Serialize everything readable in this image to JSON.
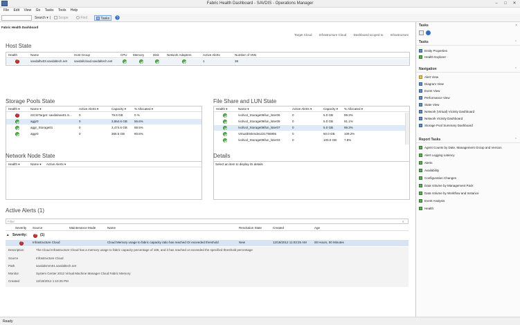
{
  "window": {
    "title": "Fabric Health Dashboard - SAVDIS - Operations Manager",
    "minimize": "–",
    "maximize": "□",
    "close": "✕"
  },
  "menu": [
    "File",
    "Edit",
    "View",
    "Go",
    "Tasks",
    "Tools",
    "Help"
  ],
  "toolbar": {
    "search_placeholder": "",
    "search": "Search",
    "scope": "Scope",
    "find": "Find",
    "tasks": "Tasks"
  },
  "dashboard": {
    "title": "Fabric Health Dashboard",
    "target_label": "Target Cloud",
    "target_value": "Infrastructure Cloud",
    "scope_label": "Dashboard scoped to",
    "scope_value": "Infrastructure"
  },
  "host_state": {
    "title": "Host State",
    "columns": [
      "Health",
      "Name",
      "Host Group",
      "CPU",
      "Memory",
      "Disk",
      "Network Adapters",
      "Active Alerts",
      "Number of VMs"
    ],
    "rows": [
      {
        "health": "critical",
        "name": "savdalhv03.savdaltech.net",
        "host_group": "savdal\\cloud.savdaltech.net",
        "cpu": "ok",
        "memory": "ok",
        "disk": "ok",
        "network": "ok",
        "alerts": "1",
        "vms": "38"
      }
    ]
  },
  "storage_pools": {
    "title": "Storage Pools State",
    "columns": [
      "Health",
      "Name",
      "Active Alerts",
      "Capacity",
      "% Allocated"
    ],
    "rows": [
      {
        "health": "critical",
        "name": "iSCSITarget: savdalnas01.S...",
        "alerts": "0",
        "capacity": "79.9 GB",
        "allocated": "0 %"
      },
      {
        "health": "ok",
        "name": "aggr0",
        "alerts": "0",
        "capacity": "3,864.6 GB",
        "allocated": "56.6%"
      },
      {
        "health": "ok",
        "name": "aggr_Storage01",
        "alerts": "0",
        "capacity": "3,474.6 GB",
        "allocated": "88.5%"
      },
      {
        "health": "ok",
        "name": "aggr0",
        "alerts": "0",
        "capacity": "365.5 GB",
        "allocated": "80.6%"
      }
    ]
  },
  "file_share": {
    "title": "File Share and LUN State",
    "columns": [
      "Health",
      "Name",
      "Active Alerts",
      "Capacity",
      "% Allocated"
    ],
    "rows": [
      {
        "health": "ok",
        "name": "/vol/vol_Storage09/lun_lster06",
        "alerts": "0",
        "capacity": "5.0 GB",
        "allocated": "99.3%"
      },
      {
        "health": "ok",
        "name": "/vol/vol_Storage09/lun_lster09",
        "alerts": "0",
        "capacity": "5.0 GB",
        "allocated": "91.1%"
      },
      {
        "health": "ok",
        "name": "/vol/vol_Storage09/lun_lster07",
        "alerts": "0",
        "capacity": "5.0 GB",
        "allocated": "99.3%"
      },
      {
        "health": "ok",
        "name": "VirtualDiskIndex221756955",
        "alerts": "0",
        "capacity": "50.0 GB",
        "allocated": "109.2%"
      },
      {
        "health": "ok",
        "name": "/vol/vol_Storage09/lun_lster03",
        "alerts": "0",
        "capacity": "100.0 GB",
        "allocated": "7.8%"
      }
    ]
  },
  "network_node": {
    "title": "Network Node State",
    "columns": [
      "Health",
      "Name",
      "Active Alerts"
    ]
  },
  "details": {
    "title": "Details",
    "placeholder": "Select an item to display its details"
  },
  "active_alerts": {
    "title": "Active Alerts (1)",
    "filter_placeholder": "Filter",
    "columns": [
      "Severity",
      "Source",
      "Maintenance Mode",
      "Name",
      "Resolution State",
      "Created",
      "Age"
    ],
    "group_label": "Severity:",
    "group_count": "(1)",
    "alert": {
      "source": "Infrastructure Cloud",
      "name": "Cloud Memory usage to fabric capacity ratio has reached Or exceeded threshold",
      "resolution": "New",
      "created": "12/18/2012 11:03:25 AM",
      "age": "00 Hours, 00 Minutes"
    },
    "detail": {
      "description_label": "Description",
      "description": "The Cloud Infrastructure Cloud has a memory usage to fabric capacity percentage of 108, and it has reached or exceeded the specified threshold percentage",
      "source_label": "Source",
      "source": "Infrastructure Cloud",
      "path_label": "Path",
      "path": "savdalvmm01.savdaltech.net",
      "monitor_label": "Monitor",
      "monitor": "System Center 2012 Virtual Machine Manager Cloud Fabric Memory",
      "created_label": "Created",
      "created": "12/18/2012 1:10:25 PM"
    }
  },
  "tasks_pane": {
    "header": "Tasks",
    "sections": {
      "tasks_label": "Tasks",
      "tasks": [
        "Entity Properties",
        "Health Explorer"
      ],
      "navigation_label": "Navigation",
      "navigation": [
        "Alert View",
        "Diagram View",
        "Event View",
        "Performance View",
        "State View",
        "Network (Virtual) Vicinity Dashboard",
        "Network Vicinity Dashboard",
        "Storage Pool Summary Dashboard"
      ],
      "report_label": "Report Tasks",
      "reports": [
        "Agent Counts by Date, Management Group and Version",
        "Alert Logging Latency",
        "Alerts",
        "Availability",
        "Configuration Changes",
        "Data Volume by Management Pack",
        "Data Volume by Workflow and Instance",
        "Event Analysis",
        "Health"
      ]
    }
  },
  "status": "Ready"
}
